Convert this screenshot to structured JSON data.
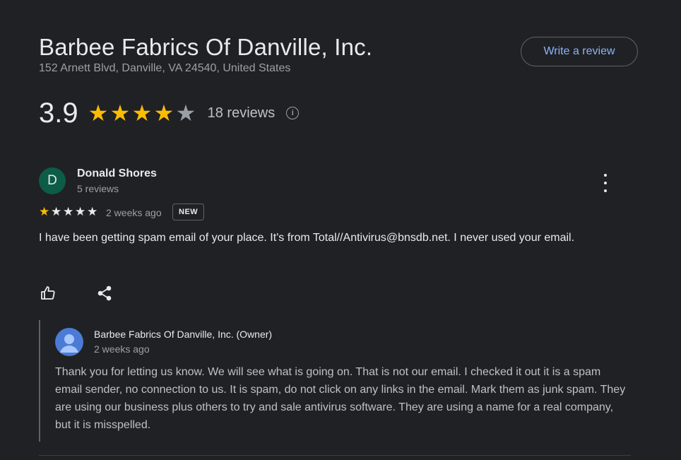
{
  "business": {
    "name": "Barbee Fabrics Of Danville, Inc.",
    "address": "152 Arnett Blvd, Danville, VA 24540, United States"
  },
  "write_review_label": "Write a review",
  "rating": {
    "value": "3.9",
    "stars_filled": 4,
    "stars_total": 5,
    "reviews_label": "18 reviews"
  },
  "review": {
    "avatar_letter": "D",
    "avatar_color": "#0d5c48",
    "reviewer_name": "Donald Shores",
    "reviewer_meta": "5 reviews",
    "stars": 1,
    "time": "2 weeks ago",
    "badge": "NEW",
    "text": "I have been getting spam email of your place. It's from Total//Antivirus@bnsdb.net. I never used your email."
  },
  "owner_reply": {
    "name": "Barbee Fabrics Of Danville, Inc. (Owner)",
    "time": "2 weeks ago",
    "text": "Thank you for letting us know. We will see what is going on. That is not our email. I checked it out it is a spam email sender, no connection to us. It is spam, do not click on any links in the email. Mark them as junk spam. They are using our business plus others to try and sale antivirus software. They are using a name for a real company, but it is misspelled."
  },
  "colors": {
    "background": "#202124",
    "star": "#fbbc04",
    "accent": "#8ab4f8"
  },
  "icons": [
    "info-icon",
    "more-vert-icon",
    "thumb-up-icon",
    "share-icon",
    "person-icon",
    "star-icon"
  ]
}
